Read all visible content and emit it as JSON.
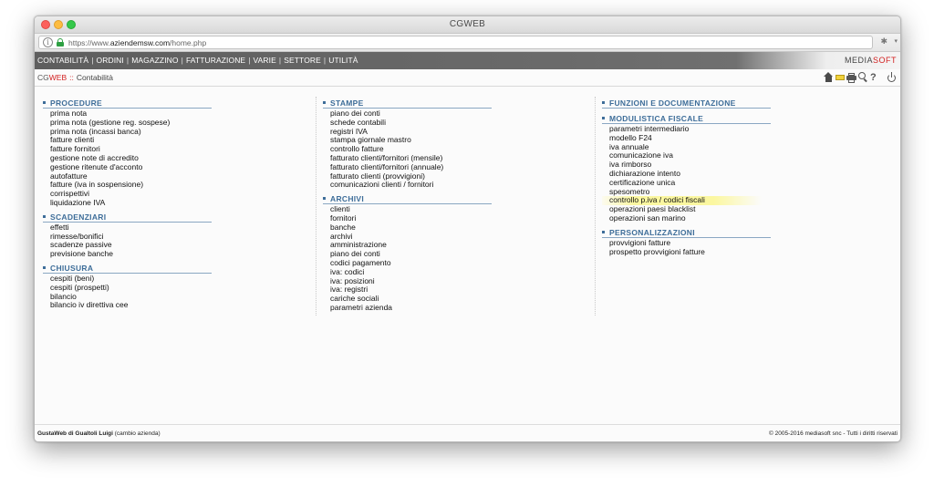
{
  "window": {
    "title": "CGWEB"
  },
  "browser": {
    "url_prefix": "https://www.",
    "url_domain": "aziendemsw.com",
    "url_path": "/home.php"
  },
  "navbar": {
    "items": [
      "CONTABILITÀ",
      "ORDINI",
      "MAGAZZINO",
      "FATTURAZIONE",
      "VARIE",
      "SETTORE",
      "UTILITÀ"
    ],
    "separator": "|",
    "brand_a": "MEDIA",
    "brand_b": "SOFT"
  },
  "subbar": {
    "app_cg": "CG",
    "app_web": "WEB",
    "sep": "::",
    "section": "Contabilità"
  },
  "columns": [
    {
      "sections": [
        {
          "title": "PROCEDURE",
          "items": [
            "prima nota",
            "prima nota (gestione reg. sospese)",
            "prima nota (incassi banca)",
            "fatture clienti",
            "fatture fornitori",
            "gestione note di accredito",
            "gestione ritenute d'acconto",
            "autofatture",
            "fatture (iva in sospensione)",
            "corrispettivi",
            "liquidazione IVA"
          ]
        },
        {
          "title": "SCADENZIARI",
          "items": [
            "effetti",
            "rimesse/bonifici",
            "scadenze passive",
            "previsione banche"
          ]
        },
        {
          "title": "CHIUSURA",
          "items": [
            "cespiti (beni)",
            "cespiti (prospetti)",
            "bilancio",
            "bilancio iv direttiva cee"
          ]
        }
      ]
    },
    {
      "sections": [
        {
          "title": "STAMPE",
          "items": [
            "piano dei conti",
            "schede contabili",
            "registri IVA",
            "stampa giornale mastro",
            "controllo fatture",
            "fatturato clienti/fornitori (mensile)",
            "fatturato clienti/fornitori (annuale)",
            "fatturato clienti (provvigioni)",
            "comunicazioni clienti / fornitori"
          ]
        },
        {
          "title": "ARCHIVI",
          "items": [
            "clienti",
            "fornitori",
            "banche",
            "archivi",
            "amministrazione",
            "piano dei conti",
            "codici pagamento",
            "iva: codici",
            "iva: posizioni",
            "iva: registri",
            "cariche sociali",
            "parametri azienda"
          ]
        }
      ]
    },
    {
      "sections": [
        {
          "title": "FUNZIONI E DOCUMENTAZIONE",
          "items": []
        },
        {
          "title": "MODULISTICA FISCALE",
          "items": [
            "parametri intermediario",
            "modello F24",
            "iva annuale",
            "comunicazione iva",
            "iva rimborso",
            "dichiarazione intento",
            "certificazione unica",
            "spesometro",
            "controllo p.iva / codici fiscali",
            "operazioni paesi blacklist",
            "operazioni san marino"
          ]
        },
        {
          "title": "PERSONALIZZAZIONI",
          "items": [
            "provvigioni fatture",
            "prospetto provvigioni fatture"
          ]
        }
      ]
    }
  ],
  "highlighted_item": "controllo p.iva / codici fiscali",
  "footer": {
    "company": "GustaWeb di Gualtoli Luigi",
    "change_link": "(cambio azienda)",
    "copyright": "© 2005-2016 mediasoft snc - Tutti i diritti riservati"
  },
  "icons": [
    "info-icon",
    "lock-icon",
    "extension-icon",
    "home-icon",
    "mail-icon",
    "print-icon",
    "zoom-icon",
    "help-icon",
    "power-icon"
  ],
  "colors": {
    "brand_red": "#d21f1f",
    "section_blue": "#3d6d99",
    "navbar_gray": "#666666",
    "highlight": "#fbf7a0"
  }
}
